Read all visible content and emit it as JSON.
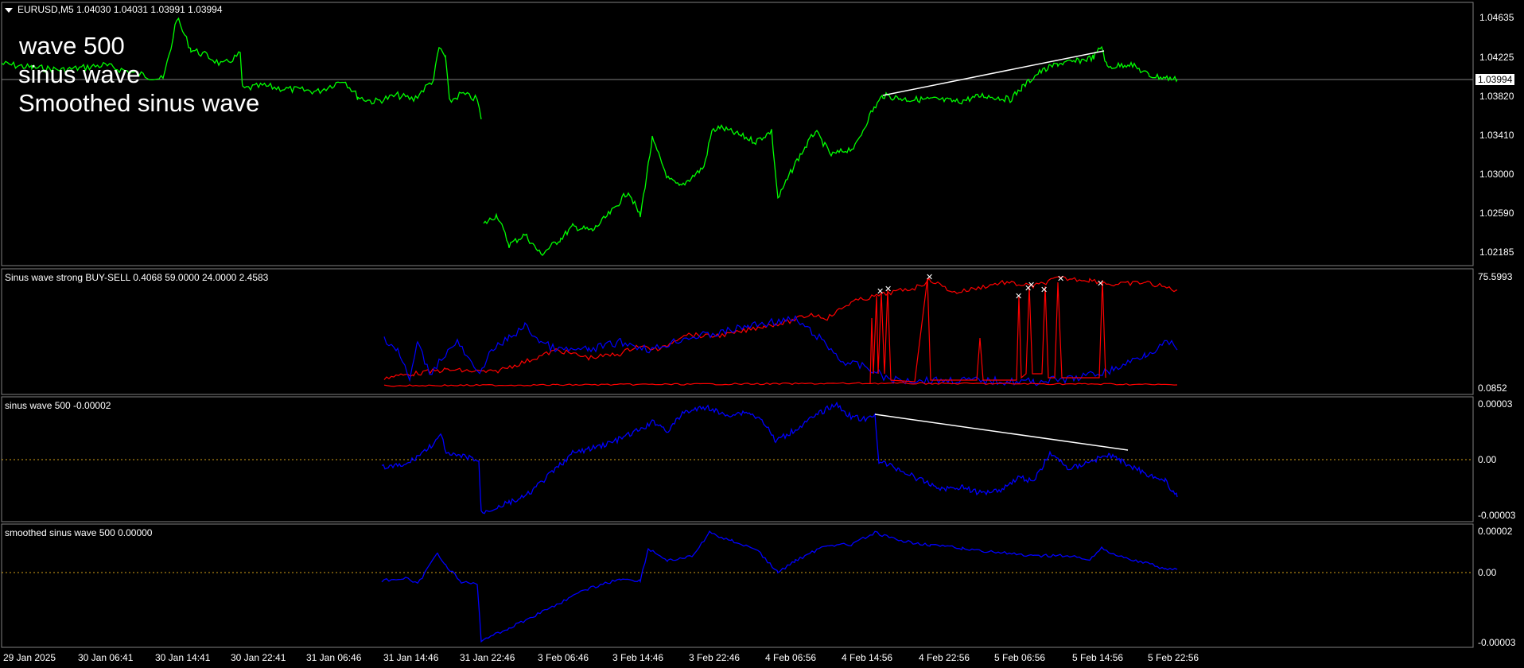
{
  "main": {
    "symbol_header": "EURUSD,M5  1.04030 1.04031 1.03991 1.03994",
    "overlay_lines": [
      "wave 500",
      "sinus wave",
      "Smoothed sinus wave"
    ],
    "current_price": "1.03994",
    "price_ticks": [
      "1.04635",
      "1.04225",
      "1.03820",
      "1.03410",
      "1.03000",
      "1.02590",
      "1.02185"
    ]
  },
  "indicator1": {
    "title": "Sinus wave strong BUY-SELL 0.4068 59.0000 24.0000 2.4583",
    "ticks": [
      "75.5993",
      "0.0852"
    ]
  },
  "indicator2": {
    "title": "sinus wave 500 -0.00002",
    "ticks": [
      "0.00003",
      "0.00",
      "-0.00003"
    ]
  },
  "indicator3": {
    "title": "smoothed sinus wave 500 0.00000",
    "ticks": [
      "0.00002",
      "0.00",
      "-0.00003"
    ]
  },
  "time_axis": [
    "29 Jan 2025",
    "30 Jan 06:41",
    "30 Jan 14:41",
    "30 Jan 22:41",
    "31 Jan 06:46",
    "31 Jan 14:46",
    "31 Jan 22:46",
    "3 Feb 06:46",
    "3 Feb 14:46",
    "3 Feb 22:46",
    "4 Feb 06:56",
    "4 Feb 14:56",
    "4 Feb 22:56",
    "5 Feb 06:56",
    "5 Feb 14:56",
    "5 Feb 22:56"
  ],
  "colors": {
    "price": "#00ff00",
    "blue": "#0000ff",
    "red": "#ff0000",
    "grid": "#808080",
    "zero": "#d4a017"
  },
  "chart_data": [
    {
      "type": "line",
      "title": "EURUSD,M5",
      "ylim": [
        1.0205,
        1.0475
      ],
      "current": 1.03994,
      "x": [
        "29 Jan 2025",
        "30 Jan 06:41",
        "30 Jan 14:41",
        "30 Jan 22:41",
        "31 Jan 06:46",
        "31 Jan 14:46",
        "31 Jan 22:46",
        "3 Feb 06:46",
        "3 Feb 14:46",
        "3 Feb 22:46",
        "4 Feb 06:56",
        "4 Feb 14:56",
        "4 Feb 22:56",
        "5 Feb 06:56",
        "5 Feb 14:56",
        "5 Feb 22:56"
      ],
      "series": [
        {
          "name": "EURUSD",
          "values": [
            1.0418,
            1.0395,
            1.042,
            1.0396,
            1.0395,
            1.039,
            1.0235,
            1.0225,
            1.0272,
            1.033,
            1.0342,
            1.0385,
            1.039,
            1.0394,
            1.0425,
            1.0399
          ]
        }
      ]
    },
    {
      "type": "line",
      "title": "Sinus wave strong BUY-SELL",
      "ylim": [
        0.0852,
        75.5993
      ],
      "x": [
        "31 Jan 14:46",
        "31 Jan 22:46",
        "3 Feb 06:46",
        "3 Feb 14:46",
        "3 Feb 22:46",
        "4 Feb 06:56",
        "4 Feb 14:56",
        "4 Feb 22:56",
        "5 Feb 06:56",
        "5 Feb 14:56",
        "5 Feb 22:56"
      ],
      "series": [
        {
          "values": [
            5,
            15,
            22,
            28,
            38,
            45,
            60,
            70,
            68,
            72,
            70
          ]
        },
        {
          "values": [
            40,
            32,
            42,
            38,
            35,
            42,
            20,
            12,
            10,
            12,
            35
          ]
        }
      ]
    },
    {
      "type": "line",
      "title": "sinus wave 500",
      "ylim": [
        -3e-05,
        3e-05
      ],
      "x": [
        "31 Jan 14:46",
        "31 Jan 22:46",
        "3 Feb 06:46",
        "3 Feb 14:46",
        "3 Feb 22:46",
        "4 Feb 06:56",
        "4 Feb 14:56",
        "4 Feb 22:56",
        "5 Feb 06:56",
        "5 Feb 14:56",
        "5 Feb 22:56"
      ],
      "series": [
        {
          "values": [
            -3e-06,
            -2.5e-05,
            -1.2e-05,
            5e-06,
            2.5e-05,
            1.5e-05,
            2.2e-05,
            -1.2e-05,
            -1e-05,
            3e-06,
            -1.8e-05
          ]
        }
      ]
    },
    {
      "type": "line",
      "title": "smoothed sinus wave 500",
      "ylim": [
        -3e-05,
        2e-05
      ],
      "x": [
        "31 Jan 14:46",
        "31 Jan 22:46",
        "3 Feb 06:46",
        "3 Feb 14:46",
        "3 Feb 22:46",
        "4 Feb 06:56",
        "4 Feb 14:56",
        "4 Feb 22:56",
        "5 Feb 06:56",
        "5 Feb 14:56",
        "5 Feb 22:56"
      ],
      "series": [
        {
          "values": [
            0.0,
            -3e-05,
            -1.8e-05,
            0.0,
            1.8e-05,
            0.0,
            1.8e-05,
            1.4e-05,
            1e-05,
            1e-05,
            0.0
          ]
        }
      ]
    }
  ]
}
